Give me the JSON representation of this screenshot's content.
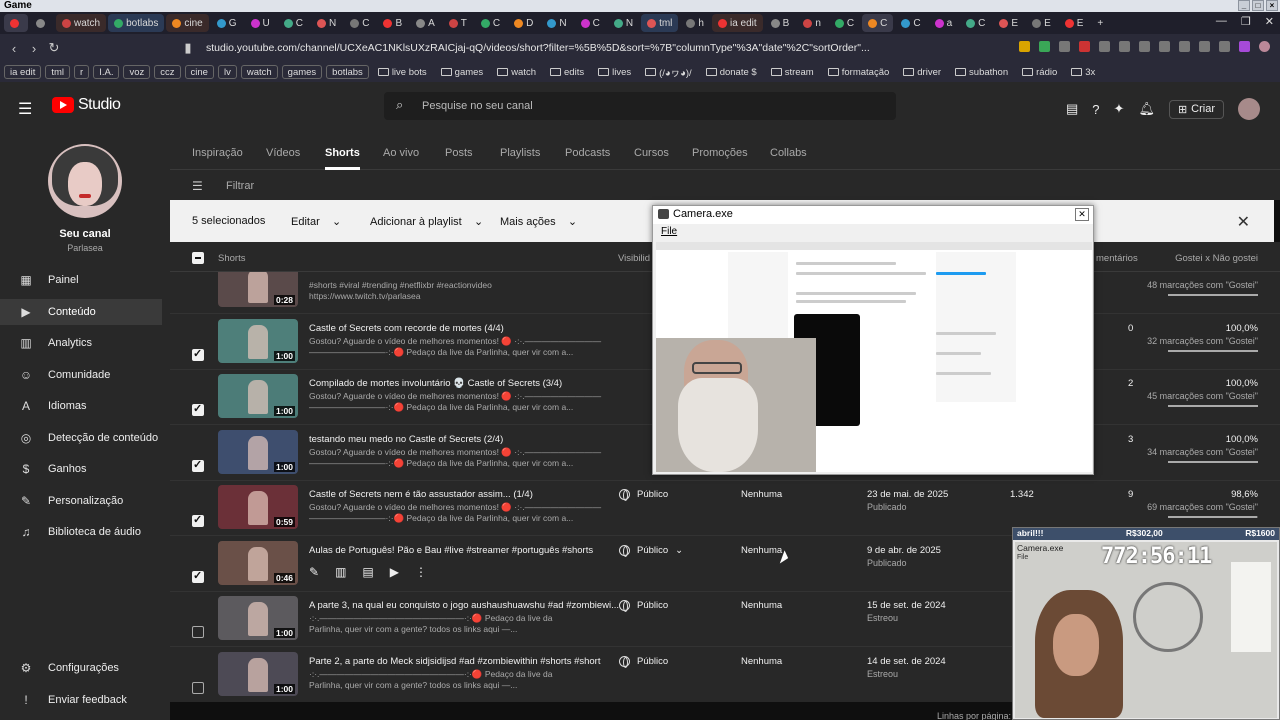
{
  "window": {
    "title": "Game"
  },
  "browser_tabs": [
    {
      "label": "",
      "style": "active"
    },
    {
      "label": "",
      "style": "plain"
    },
    {
      "label": "watch",
      "style": "named"
    },
    {
      "label": "botlabs",
      "style": "blue"
    },
    {
      "label": "cine",
      "style": "named"
    },
    {
      "label": "G",
      "style": "plain"
    },
    {
      "label": "U",
      "style": "plain"
    },
    {
      "label": "C",
      "style": "plain"
    },
    {
      "label": "N",
      "style": "plain"
    },
    {
      "label": "C",
      "style": "plain"
    },
    {
      "label": "B",
      "style": "plain"
    },
    {
      "label": "A",
      "style": "plain"
    },
    {
      "label": "T",
      "style": "plain"
    },
    {
      "label": "C",
      "style": "plain"
    },
    {
      "label": "D",
      "style": "plain"
    },
    {
      "label": "N",
      "style": "plain"
    },
    {
      "label": "C",
      "style": "plain"
    },
    {
      "label": "N",
      "style": "plain"
    },
    {
      "label": "tml",
      "style": "blue"
    },
    {
      "label": "h",
      "style": "plain"
    },
    {
      "label": "ia edit",
      "style": "named"
    },
    {
      "label": "B",
      "style": "plain"
    },
    {
      "label": "n",
      "style": "plain"
    },
    {
      "label": "C",
      "style": "plain"
    },
    {
      "label": "C",
      "style": "active"
    },
    {
      "label": "C",
      "style": "plain"
    },
    {
      "label": "a",
      "style": "plain"
    },
    {
      "label": "C",
      "style": "plain"
    },
    {
      "label": "E",
      "style": "plain"
    },
    {
      "label": "E",
      "style": "plain"
    },
    {
      "label": "E",
      "style": "plain"
    }
  ],
  "address": {
    "url": "studio.youtube.com/channel/UCXeAC1NKlsUXzRAICjaj-qQ/videos/short?filter=%5B%5D&sort=%7B\"columnType\"%3A\"date\"%2C\"sortOrder\"..."
  },
  "bookmarks": [
    {
      "label": "ia edit",
      "chip": true
    },
    {
      "label": "tml",
      "chip": true
    },
    {
      "label": "r",
      "chip": true
    },
    {
      "label": "I.A.",
      "chip": true
    },
    {
      "label": "voz",
      "chip": true
    },
    {
      "label": "ccz",
      "chip": true
    },
    {
      "label": "cine",
      "chip": true
    },
    {
      "label": "lv",
      "chip": true
    },
    {
      "label": "watch",
      "chip": true
    },
    {
      "label": "games",
      "chip": true
    },
    {
      "label": "botlabs",
      "chip": true
    },
    {
      "label": "live bots",
      "chip": false
    },
    {
      "label": "games",
      "chip": false
    },
    {
      "label": "watch",
      "chip": false
    },
    {
      "label": "edits",
      "chip": false
    },
    {
      "label": "lives",
      "chip": false
    },
    {
      "label": "(/◕ヮ◕)/",
      "chip": false
    },
    {
      "label": "donate $",
      "chip": false
    },
    {
      "label": "stream",
      "chip": false
    },
    {
      "label": "formatação",
      "chip": false
    },
    {
      "label": "driver",
      "chip": false
    },
    {
      "label": "subathon",
      "chip": false
    },
    {
      "label": "rádio",
      "chip": false
    },
    {
      "label": "3x",
      "chip": false
    }
  ],
  "header": {
    "logo_text": "Studio",
    "search_placeholder": "Pesquise no seu canal",
    "create_label": "Criar"
  },
  "sidebar": {
    "channel_name": "Seu canal",
    "channel_handle": "Parlasea",
    "items": [
      {
        "label": "Painel",
        "icon": "dashboard-icon",
        "glyph": "▦",
        "active": false
      },
      {
        "label": "Conteúdo",
        "icon": "content-icon",
        "glyph": "▶",
        "active": true
      },
      {
        "label": "Analytics",
        "icon": "analytics-icon",
        "glyph": "▥",
        "active": false
      },
      {
        "label": "Comunidade",
        "icon": "community-icon",
        "glyph": "☺",
        "active": false
      },
      {
        "label": "Idiomas",
        "icon": "languages-icon",
        "glyph": "A",
        "active": false
      },
      {
        "label": "Detecção de conteúdo",
        "icon": "content-detection-icon",
        "glyph": "◎",
        "active": false
      },
      {
        "label": "Ganhos",
        "icon": "earn-icon",
        "glyph": "$",
        "active": false
      },
      {
        "label": "Personalização",
        "icon": "customization-icon",
        "glyph": "✎",
        "active": false
      },
      {
        "label": "Biblioteca de áudio",
        "icon": "audio-library-icon",
        "glyph": "♫",
        "active": false
      }
    ],
    "settings_label": "Configurações",
    "feedback_label": "Enviar feedback"
  },
  "content_tabs": [
    {
      "label": "Inspiração",
      "active": false
    },
    {
      "label": "Vídeos",
      "active": false
    },
    {
      "label": "Shorts",
      "active": true
    },
    {
      "label": "Ao vivo",
      "active": false
    },
    {
      "label": "Posts",
      "active": false
    },
    {
      "label": "Playlists",
      "active": false
    },
    {
      "label": "Podcasts",
      "active": false
    },
    {
      "label": "Cursos",
      "active": false
    },
    {
      "label": "Promoções",
      "active": false
    },
    {
      "label": "Collabs",
      "active": false
    }
  ],
  "filter": {
    "placeholder": "Filtrar"
  },
  "selection": {
    "count_label": "5 selecionados",
    "edit_label": "Editar",
    "playlist_label": "Adicionar à playlist",
    "more_label": "Mais ações"
  },
  "table": {
    "headers": {
      "shorts": "Shorts",
      "visibility": "Visibilid",
      "comments": "mentários",
      "likes": "Gostei x Não gostei"
    },
    "rows": [
      {
        "checked": false,
        "partial": true,
        "title": "",
        "desc1": "#shorts #viral #trending #netflixbr #reactionvideo",
        "desc2": "https://www.twitch.tv/parlasea",
        "duration": "0:28",
        "visibility": "",
        "restrictions": "",
        "date": "",
        "date_status": "",
        "views": "",
        "comments": "",
        "likes_pct": "",
        "likes_count": "48 marcações com \"Gostei\"",
        "thumb_color": "#5a4a4a"
      },
      {
        "checked": true,
        "title": "Castle of Secrets com recorde de mortes (4/4)",
        "desc1": "Gostou? Aguarde o vídeo de melhores momentos! 🔴 ·:·.—————————",
        "desc2": "—————————·:·🔴 Pedaço da live da Parlinha, quer vir com a...",
        "duration": "1:00",
        "visibility": "",
        "restrictions": "",
        "date": "",
        "date_status": "",
        "views": "",
        "comments": "0",
        "likes_pct": "100,0%",
        "likes_count": "32 marcações com \"Gostei\"",
        "thumb_color": "#4e7f7a"
      },
      {
        "checked": true,
        "title": "Compilado de mortes involuntário 💀 Castle of Secrets (3/4)",
        "desc1": "Gostou? Aguarde o vídeo de melhores momentos! 🔴 ·:·.—————————",
        "desc2": "—————————·:·🔴 Pedaço da live da Parlinha, quer vir com a...",
        "duration": "1:00",
        "visibility": "",
        "restrictions": "",
        "date": "",
        "date_status": "",
        "views": "",
        "comments": "2",
        "likes_pct": "100,0%",
        "likes_count": "45 marcações com \"Gostei\"",
        "thumb_color": "#4c7c78"
      },
      {
        "checked": true,
        "title": "testando meu medo no Castle of Secrets (2/4)",
        "desc1": "Gostou? Aguarde o vídeo de melhores momentos! 🔴 ·:·.—————————",
        "desc2": "—————————·:·🔴 Pedaço da live da Parlinha, quer vir com a...",
        "duration": "1:00",
        "visibility": "",
        "restrictions": "",
        "date": "",
        "date_status": "",
        "views": "",
        "comments": "3",
        "likes_pct": "100,0%",
        "likes_count": "34 marcações com \"Gostei\"",
        "thumb_color": "#3e4e6e"
      },
      {
        "checked": true,
        "title": "Castle of Secrets nem é tão assustador assim... (1/4)",
        "desc1": "Gostou? Aguarde o vídeo de melhores momentos! 🔴 ·:·.—————————",
        "desc2": "—————————·:·🔴 Pedaço da live da Parlinha, quer vir com a...",
        "duration": "0:59",
        "visibility": "Público",
        "restrictions": "Nenhuma",
        "date": "23 de mai. de 2025",
        "date_status": "Publicado",
        "views": "1.342",
        "comments": "9",
        "likes_pct": "98,6%",
        "likes_count": "69 marcações com \"Gostei\"",
        "thumb_color": "#6b3038"
      },
      {
        "checked": true,
        "hover": true,
        "title": "Aulas de Português! Pão e Bau #live #streamer #português #shorts",
        "desc1": "",
        "desc2": "",
        "duration": "0:46",
        "visibility": "Público",
        "restrictions": "Nenhuma",
        "date": "9 de abr. de 2025",
        "date_status": "Publicado",
        "views": "",
        "comments": "",
        "likes_pct": "",
        "likes_count": "",
        "thumb_color": "#6a5048"
      },
      {
        "checked": false,
        "title": "A parte 3, na qual eu conquisto o jogo aushaushuawshu #ad #zombiewi...",
        "desc1": "·:·.—————————————————·:·🔴 Pedaço da live da",
        "desc2": "Parlinha, quer vir com a gente? todos os links aqui —...",
        "duration": "1:00",
        "visibility": "Público",
        "restrictions": "Nenhuma",
        "date": "15 de set. de 2024",
        "date_status": "Estreou",
        "views": "",
        "comments": "",
        "likes_pct": "",
        "likes_count": "",
        "thumb_color": "#5c5a5e"
      },
      {
        "checked": false,
        "title": "Parte 2, a parte do Meck sidjsidijsd #ad #zombiewithin #shorts #short",
        "desc1": "·:·.—————————————————·:·🔴 Pedaço da live da",
        "desc2": "Parlinha, quer vir com a gente? todos os links aqui —...",
        "duration": "1:00",
        "visibility": "Público",
        "restrictions": "Nenhuma",
        "date": "14 de set. de 2024",
        "date_status": "Estreou",
        "views": "",
        "comments": "",
        "likes_pct": "",
        "likes_count": "",
        "thumb_color": "#4d4a55"
      }
    ],
    "footer": "Linhas por página:"
  },
  "camera_window": {
    "title": "Camera.exe",
    "menu": "File"
  },
  "overlay": {
    "name": "abril!!!",
    "goal_current": "R$302,00",
    "goal_target": "R$1600",
    "timer": "772:56:11",
    "cam_label": "Camera.exe",
    "cam_menu": "File"
  }
}
